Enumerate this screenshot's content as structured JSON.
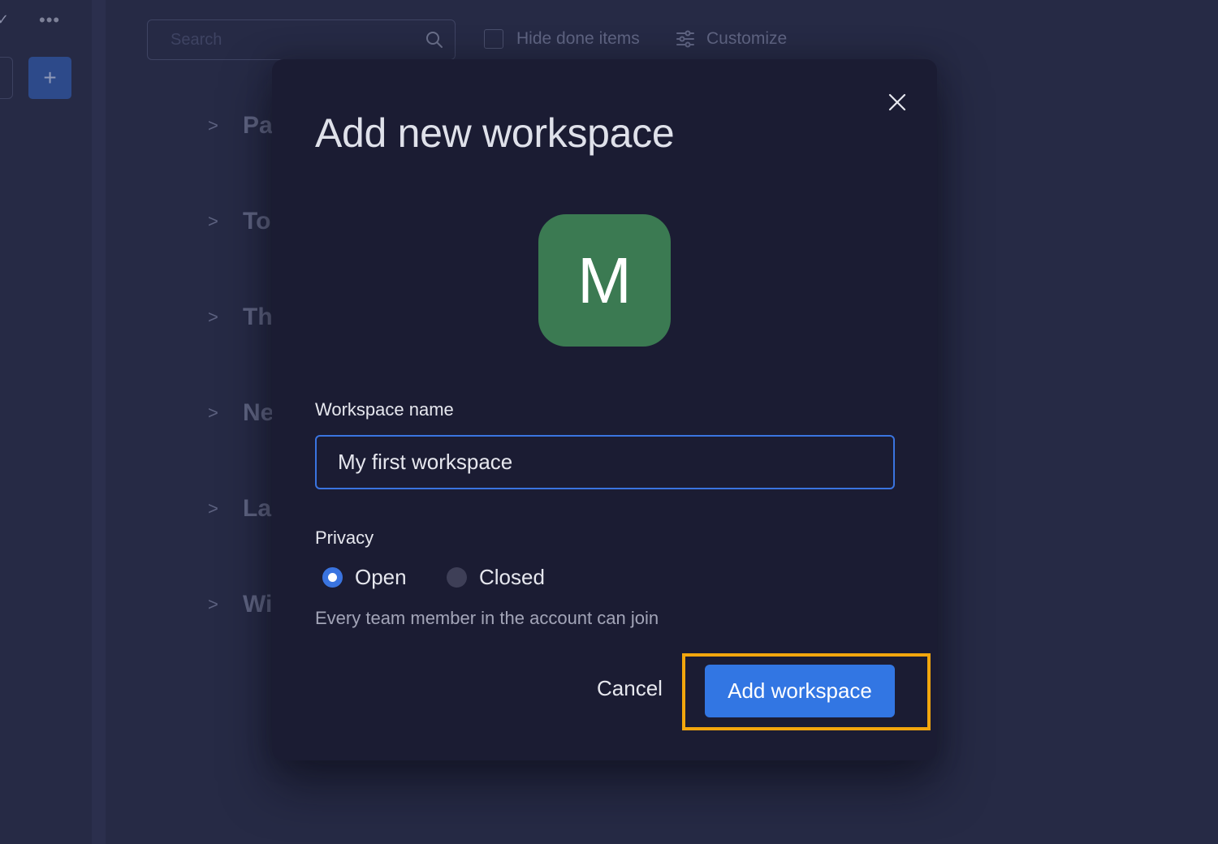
{
  "background": {
    "rail": {
      "more_label": "•••",
      "add_label": "+"
    },
    "toolbar": {
      "search_placeholder": "Search",
      "hide_done_label": "Hide done items",
      "customize_label": "Customize"
    },
    "groups": [
      {
        "label": "Pa"
      },
      {
        "label": "To"
      },
      {
        "label": "Th"
      },
      {
        "label": "Ne"
      },
      {
        "label": "La"
      },
      {
        "label": "Wi"
      }
    ]
  },
  "modal": {
    "title": "Add new workspace",
    "avatar_letter": "M",
    "avatar_color": "#3b7a52",
    "name_label": "Workspace name",
    "name_value": "My first workspace",
    "privacy_label": "Privacy",
    "privacy_options": [
      {
        "label": "Open",
        "selected": true
      },
      {
        "label": "Closed",
        "selected": false
      }
    ],
    "privacy_hint": "Every team member in the account can join",
    "cancel_label": "Cancel",
    "submit_label": "Add workspace",
    "accent_color": "#3276e3",
    "highlight_color": "#f2a60d"
  }
}
